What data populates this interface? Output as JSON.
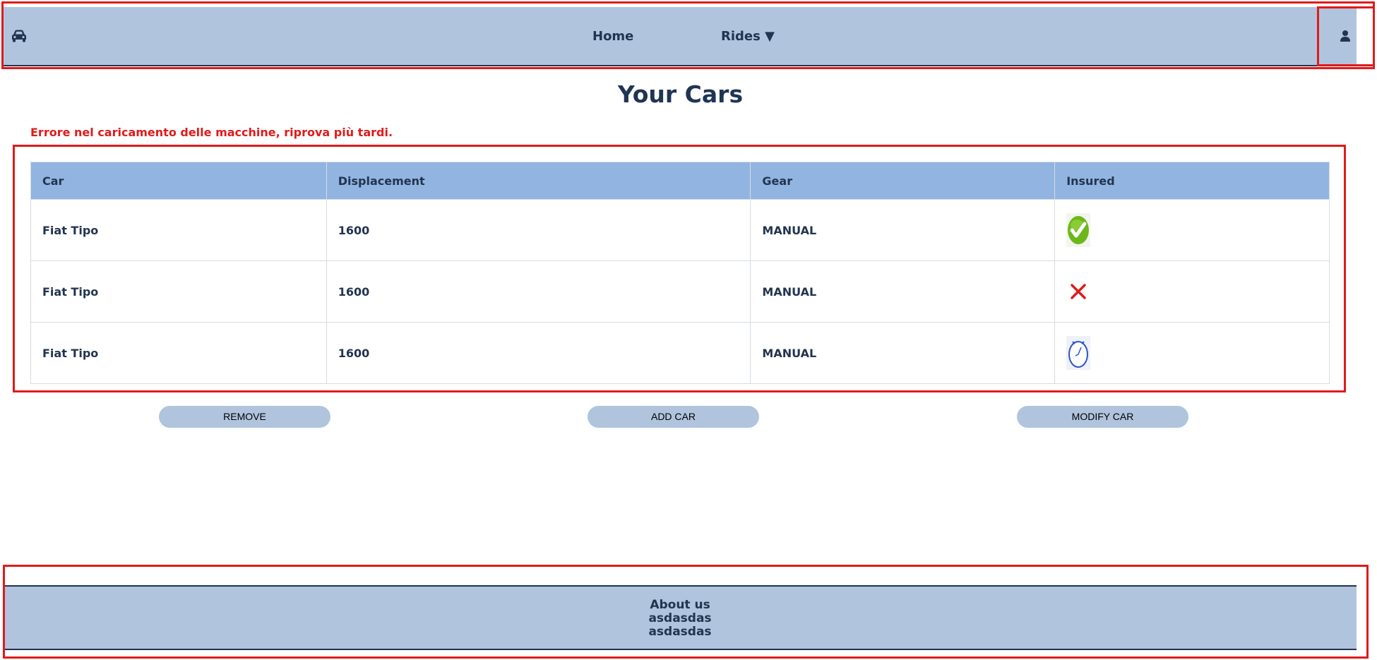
{
  "navbar": {
    "logo_icon": "car-icon",
    "links": [
      {
        "label": "Home"
      },
      {
        "label": "Rides ▼"
      }
    ],
    "user_icon": "user-icon"
  },
  "page": {
    "title": "Your Cars",
    "error": "Errore nel caricamento delle macchine, riprova più tardi."
  },
  "table": {
    "columns": [
      "Car",
      "Displacement",
      "Gear",
      "Insured"
    ],
    "rows": [
      {
        "car": "Fiat Tipo",
        "displacement": "1600",
        "gear": "MANUAL",
        "insured_icon": "green-check-icon"
      },
      {
        "car": "Fiat Tipo",
        "displacement": "1600",
        "gear": "MANUAL",
        "insured_icon": "red-x-icon"
      },
      {
        "car": "Fiat Tipo",
        "displacement": "1600",
        "gear": "MANUAL",
        "insured_icon": "pending-clock-icon"
      }
    ]
  },
  "actions": {
    "remove": "REMOVE",
    "add": "ADD CAR",
    "modify": "MODIFY CAR"
  },
  "footer": {
    "lines": [
      "About us",
      "asdasdas",
      "asdasdas"
    ]
  },
  "colors": {
    "nav_bg": "#b0c4de",
    "header_bg": "#92b4e1",
    "text": "#1e3554",
    "error": "#e01b1b"
  }
}
